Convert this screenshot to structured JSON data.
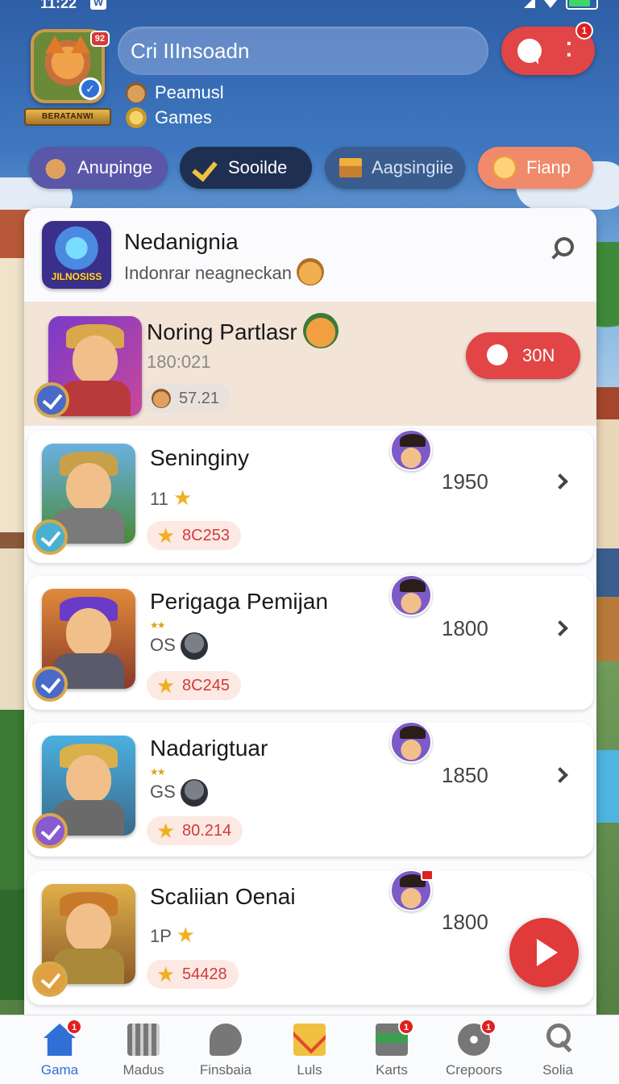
{
  "status_bar": {
    "time": "11:22",
    "w_badge": "W"
  },
  "header": {
    "avatar_level": "92",
    "avatar_name": "BERATANWI",
    "search_text": "Cri IIInsoadn",
    "chat_badge": "1",
    "stats": [
      {
        "icon": "hamster-icon",
        "label": "Peamusl"
      },
      {
        "icon": "coin-icon",
        "label": "Games"
      }
    ]
  },
  "chips": [
    {
      "icon": "hamster-icon",
      "label": "Anupinge"
    },
    {
      "icon": "checkmark-icon",
      "label": "Sooilde"
    },
    {
      "icon": "bench-icon",
      "label": "Aagsingiie"
    },
    {
      "icon": "smiley-icon",
      "label": "Fianp"
    }
  ],
  "panel": {
    "logo_text": "JILNOSISS",
    "title": "Nedanignia",
    "subtitle": "Indonrar neagneckan"
  },
  "featured": {
    "name": "Noring Partlasr",
    "meta": "180:021",
    "score": "57.21",
    "join_label": "30N"
  },
  "rows": [
    {
      "name": "Seninginy",
      "meta": "11",
      "score": "8C253",
      "opponent_score": "1950"
    },
    {
      "name": "Perigaga Pemijan",
      "meta": "OS",
      "score": "8C245",
      "opponent_score": "1800"
    },
    {
      "name": "Nadarigtuar",
      "meta": "GS",
      "score": "80.214",
      "opponent_score": "1850"
    },
    {
      "name": "Scaliian Oenai",
      "meta": "1P",
      "score": "54428",
      "opponent_score": "1800"
    }
  ],
  "bottom_nav": [
    {
      "icon": "home-icon",
      "label": "Gama",
      "badge": "1",
      "active": true
    },
    {
      "icon": "grid-icon",
      "label": "Madus",
      "badge": ""
    },
    {
      "icon": "chat-icon",
      "label": "Finsbaia",
      "badge": ""
    },
    {
      "icon": "mail-icon",
      "label": "Luls",
      "badge": ""
    },
    {
      "icon": "cards-icon",
      "label": "Karts",
      "badge": "1"
    },
    {
      "icon": "gear-icon",
      "label": "Crepoors",
      "badge": "1"
    },
    {
      "icon": "search-icon",
      "label": "Solia",
      "badge": ""
    }
  ],
  "colors": {
    "accent": "#e14545",
    "active_tab": "#2f6fd6",
    "panel": "#fbfbfd"
  }
}
